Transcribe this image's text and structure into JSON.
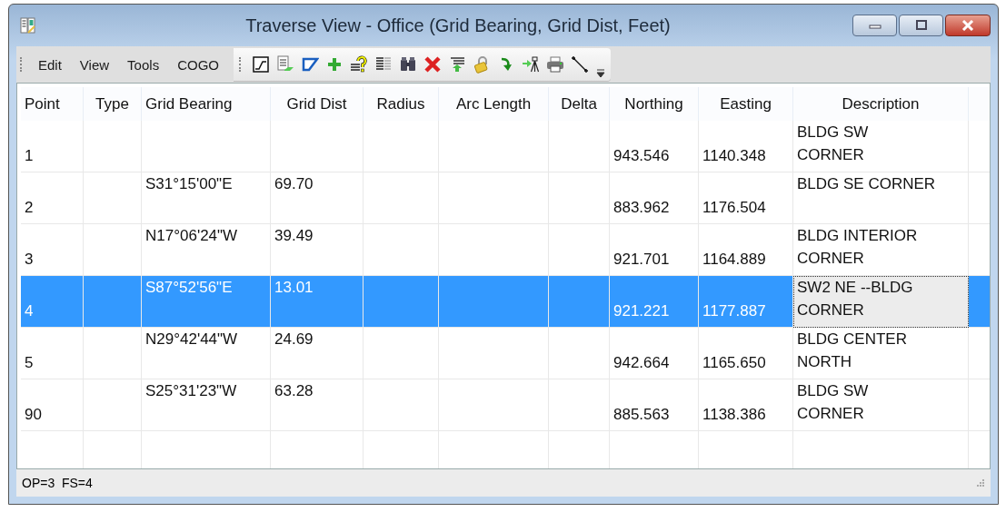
{
  "window": {
    "title": "Traverse View - Office (Grid Bearing, Grid Dist, Feet)"
  },
  "menu": [
    {
      "label": "Edit"
    },
    {
      "label": "View"
    },
    {
      "label": "Tools"
    },
    {
      "label": "COGO"
    }
  ],
  "toolbar": [
    {
      "kind": "line-box"
    },
    {
      "kind": "document"
    },
    {
      "kind": "parallelogram"
    },
    {
      "kind": "plus"
    },
    {
      "kind": "question"
    },
    {
      "kind": "list"
    },
    {
      "kind": "binoculars"
    },
    {
      "kind": "delete"
    },
    {
      "kind": "lines-up"
    },
    {
      "kind": "lock"
    },
    {
      "kind": "curve-arrow"
    },
    {
      "kind": "arrow-tripod"
    },
    {
      "kind": "printer"
    },
    {
      "kind": "line-plus"
    }
  ],
  "table": {
    "columns": [
      "Point",
      "Type",
      "Grid Bearing",
      "Grid Dist",
      "Radius",
      "Arc Length",
      "Delta",
      "Northing",
      "Easting",
      "Description"
    ],
    "rows": [
      {
        "point": "1",
        "northing": "943.546",
        "easting": "1140.348",
        "description": "BLDG SW\nCORNER",
        "selected": false
      },
      {
        "point": "2",
        "grid_bearing": "S31°15'00\"E",
        "grid_dist": "69.70",
        "northing": "883.962",
        "easting": "1176.504",
        "description": "BLDG SE CORNER",
        "selected": false
      },
      {
        "point": "3",
        "grid_bearing": "N17°06'24\"W",
        "grid_dist": "39.49",
        "northing": "921.701",
        "easting": "1164.889",
        "description": "BLDG INTERIOR\nCORNER",
        "selected": false
      },
      {
        "point": "4",
        "grid_bearing": "S87°52'56\"E",
        "grid_dist": "13.01",
        "northing": "921.221",
        "easting": "1177.887",
        "description": "SW2 NE --BLDG\nCORNER",
        "selected": true
      },
      {
        "point": "5",
        "grid_bearing": "N29°42'44\"W",
        "grid_dist": "24.69",
        "northing": "942.664",
        "easting": "1165.650",
        "description": "BLDG CENTER\nNORTH",
        "selected": false
      },
      {
        "point": "90",
        "grid_bearing": "S25°31'23\"W",
        "grid_dist": "63.28",
        "northing": "885.563",
        "easting": "1138.386",
        "description": "BLDG SW\nCORNER",
        "selected": false
      }
    ]
  },
  "status_bar": {
    "text": "OP=3  FS=4"
  }
}
